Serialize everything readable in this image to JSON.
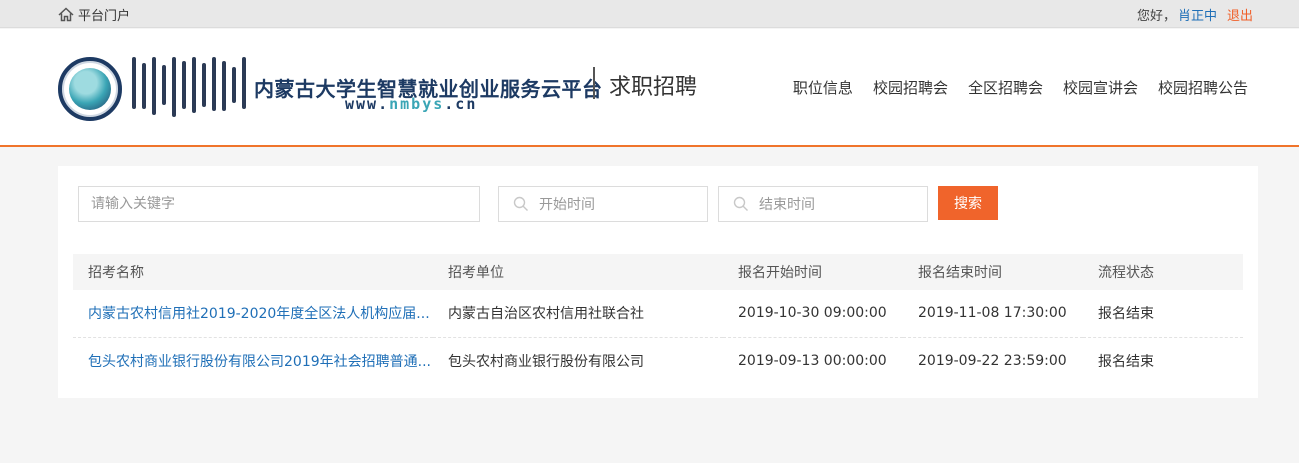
{
  "topbar": {
    "portal_label": "平台门户",
    "greeting": "您好，",
    "username": "肖正中",
    "logout": "退出"
  },
  "header": {
    "brand_title": "内蒙古大学生智慧就业创业服务云平台",
    "brand_url_prefix": "www.",
    "brand_url_highlight": "nmbys",
    "brand_url_suffix": ".cn",
    "section_title": "求职招聘",
    "nav": [
      "职位信息",
      "校园招聘会",
      "全区招聘会",
      "校园宣讲会",
      "校园招聘公告"
    ]
  },
  "search": {
    "keyword_placeholder": "请输入关键字",
    "start_placeholder": "开始时间",
    "end_placeholder": "结束时间",
    "button": "搜索"
  },
  "table": {
    "headers": [
      "招考名称",
      "招考单位",
      "报名开始时间",
      "报名结束时间",
      "流程状态"
    ],
    "rows": [
      [
        "内蒙古农村信用社2019-2020年度全区法人机构应届...",
        "内蒙古自治区农村信用社联合社",
        "2019-10-30 09:00:00",
        "2019-11-08 17:30:00",
        "报名结束"
      ],
      [
        "包头农村商业银行股份有限公司2019年社会招聘普通...",
        "包头农村商业银行股份有限公司",
        "2019-09-13 00:00:00",
        "2019-09-22 23:59:00",
        "报名结束"
      ]
    ]
  },
  "colors": {
    "accent": "#f0642b",
    "link": "#1f6fb7",
    "brand": "#1d3a63"
  }
}
